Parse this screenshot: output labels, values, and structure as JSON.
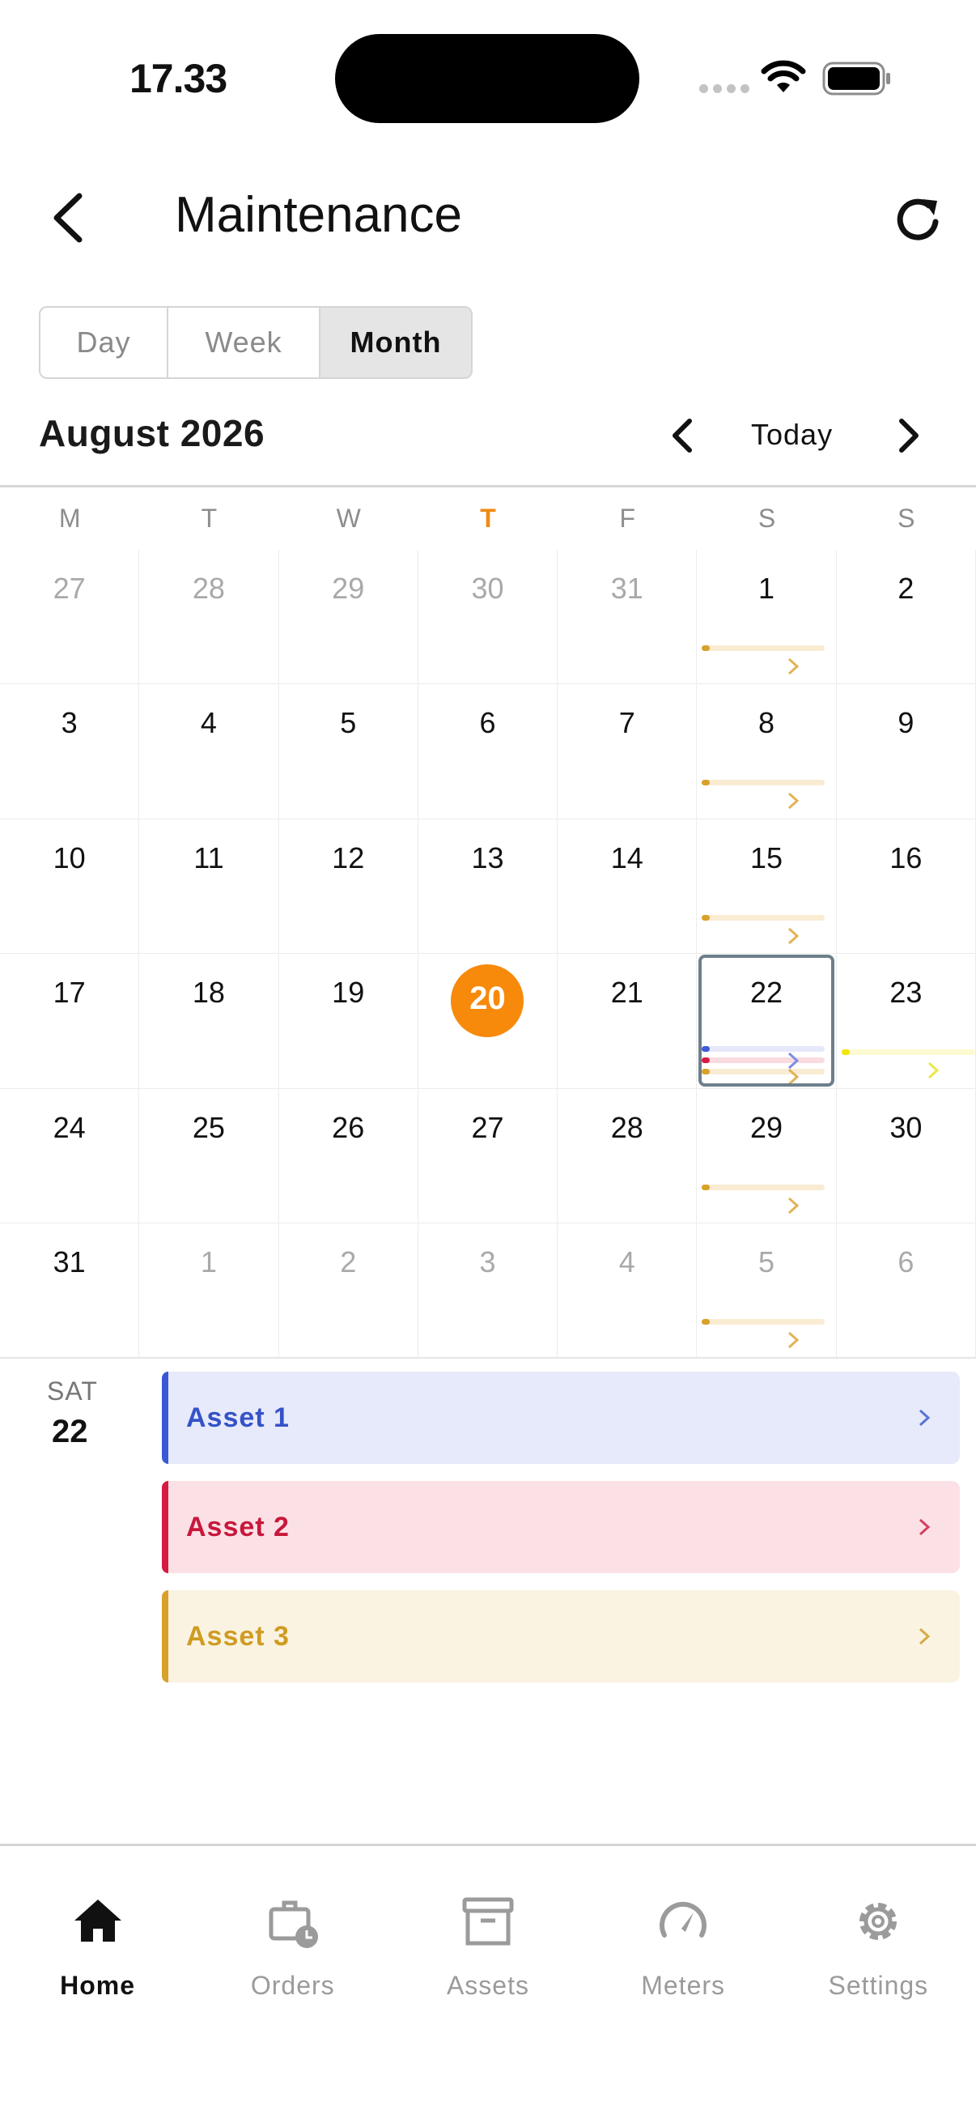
{
  "status_bar": {
    "time": "17.33"
  },
  "header": {
    "title": "Maintenance"
  },
  "view_switch": {
    "options": [
      "Day",
      "Week",
      "Month"
    ],
    "selected": "Month"
  },
  "calendar": {
    "month_label": "August 2026",
    "today_label": "Today",
    "weekdays": [
      "M",
      "T",
      "W",
      "T",
      "F",
      "S",
      "S"
    ],
    "highlight_weekday_index": 3,
    "weeks": [
      [
        "27",
        "28",
        "29",
        "30",
        "31",
        "1",
        "2"
      ],
      [
        "3",
        "4",
        "5",
        "6",
        "7",
        "8",
        "9"
      ],
      [
        "10",
        "11",
        "12",
        "13",
        "14",
        "15",
        "16"
      ],
      [
        "17",
        "18",
        "19",
        "20",
        "21",
        "22",
        "23"
      ],
      [
        "24",
        "25",
        "26",
        "27",
        "28",
        "29",
        "30"
      ],
      [
        "31",
        "1",
        "2",
        "3",
        "4",
        "5",
        "6"
      ]
    ],
    "today": "20",
    "selected": "22"
  },
  "agenda": {
    "day_of_week": "SAT",
    "day": "22",
    "items": [
      {
        "label": "Asset 1",
        "color": "#3a58d6"
      },
      {
        "label": "Asset 2",
        "color": "#d61a41"
      },
      {
        "label": "Asset 3",
        "color": "#d8a12a"
      }
    ]
  },
  "tabbar": {
    "items": [
      {
        "label": "Home",
        "icon": "home-icon",
        "active": true
      },
      {
        "label": "Orders",
        "icon": "briefcase-clock-icon"
      },
      {
        "label": "Assets",
        "icon": "archive-box-icon"
      },
      {
        "label": "Meters",
        "icon": "speedometer-icon"
      },
      {
        "label": "Settings",
        "icon": "gear-icon"
      }
    ]
  },
  "colors": {
    "accent": "#f78a0b",
    "selected_border": "#6d7f8b"
  }
}
